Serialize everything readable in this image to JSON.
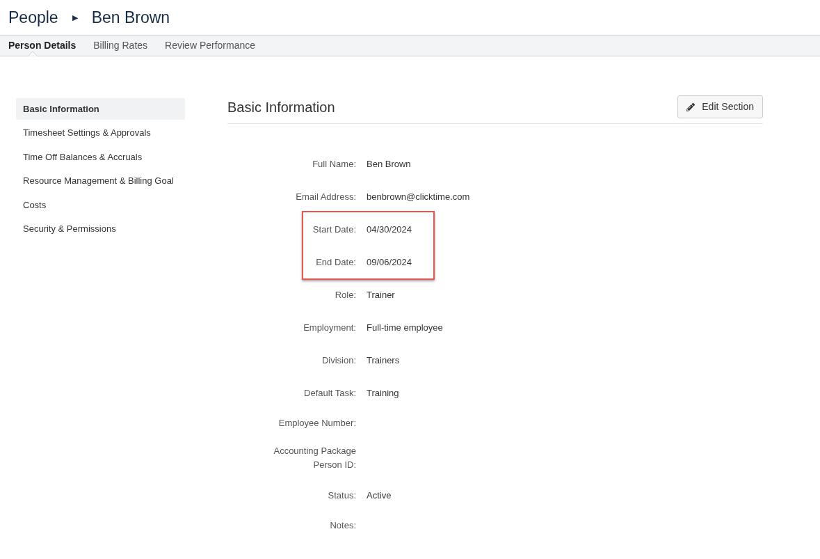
{
  "breadcrumb": {
    "parent": "People",
    "separator": "▶",
    "current": "Ben Brown"
  },
  "tabs": [
    {
      "label": "Person Details",
      "selected": true
    },
    {
      "label": "Billing Rates",
      "selected": false
    },
    {
      "label": "Review Performance",
      "selected": false
    }
  ],
  "sidebar": {
    "items": [
      {
        "label": "Basic Information",
        "selected": true
      },
      {
        "label": "Timesheet Settings & Approvals",
        "selected": false
      },
      {
        "label": "Time Off Balances & Accruals",
        "selected": false
      },
      {
        "label": "Resource Management & Billing Goal",
        "selected": false
      },
      {
        "label": "Costs",
        "selected": false
      },
      {
        "label": "Security & Permissions",
        "selected": false
      }
    ]
  },
  "section": {
    "title": "Basic Information",
    "edit_button": "Edit Section",
    "fields": [
      {
        "label": "Full Name:",
        "value": "Ben Brown",
        "highlighted": false
      },
      {
        "label": "Email Address:",
        "value": "benbrown@clicktime.com",
        "highlighted": false
      },
      {
        "label": "Start Date:",
        "value": "04/30/2024",
        "highlighted": true
      },
      {
        "label": "End Date:",
        "value": "09/06/2024",
        "highlighted": true
      },
      {
        "label": "Role:",
        "value": "Trainer",
        "highlighted": false
      },
      {
        "label": "Employment:",
        "value": "Full-time employee",
        "highlighted": false
      },
      {
        "label": "Division:",
        "value": "Trainers",
        "highlighted": false
      },
      {
        "label": "Default Task:",
        "value": "Training",
        "highlighted": false
      },
      {
        "label": "Employee Number:",
        "highlighted": false
      },
      {
        "label": "Accounting Package Person ID:",
        "highlighted": false
      },
      {
        "label": "Status:",
        "value": "Active",
        "highlighted": false
      },
      {
        "label": "Notes:",
        "highlighted": false
      }
    ]
  }
}
